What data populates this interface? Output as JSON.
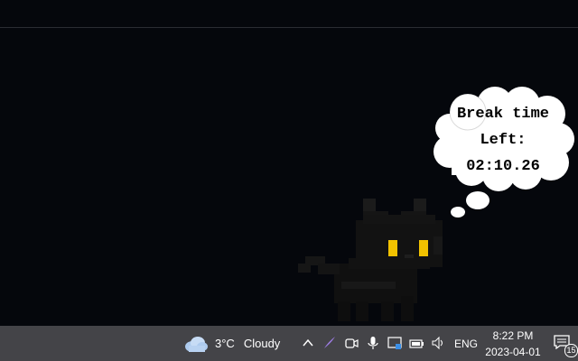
{
  "desktop": {
    "thought_bubble": {
      "line1": "Break time",
      "line2": "Left:",
      "line3": "02:10.26"
    }
  },
  "taskbar": {
    "weather": {
      "icon": "cloud-icon",
      "temperature": "3°C",
      "condition": "Cloudy"
    },
    "tray": {
      "icons": [
        "chevron-up-icon",
        "pen-icon",
        "camera-icon",
        "microphone-icon",
        "display-icon",
        "battery-icon",
        "speaker-icon"
      ],
      "language": "ENG"
    },
    "clock": {
      "time": "8:22 PM",
      "date": "2023-04-01"
    },
    "notifications": {
      "icon": "notification-icon",
      "count": "15"
    }
  }
}
